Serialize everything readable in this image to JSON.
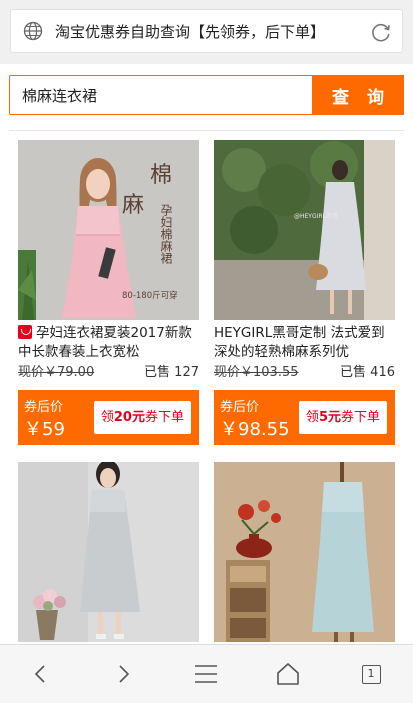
{
  "address_bar": {
    "title": "淘宝优惠券自助查询【先领券，后下单】"
  },
  "search": {
    "value": "棉麻连衣裙",
    "button_label": "查 询"
  },
  "products": [
    {
      "title": "孕妇连衣裙夏装2017新款中长款春装上衣宽松",
      "tmall_badge": true,
      "image_caption_big": [
        "棉",
        "麻"
      ],
      "image_caption_small": "孕妇棉麻裙",
      "image_caption_size": "80-180斤可穿",
      "was_price": "现价￥79.00",
      "sold": "已售 127",
      "after_label": "券后价",
      "after_price": "￥59",
      "coupon_prefix": "领",
      "coupon_amount": "20元",
      "coupon_suffix": "券下单"
    },
    {
      "title": "HEYGIRL黑哥定制 法式爱到深处的轻熟棉麻系列优",
      "tmall_badge": false,
      "image_watermark": "@HEYGIRL黑哥",
      "was_price": "现价￥103.55",
      "sold": "已售 416",
      "after_label": "券后价",
      "after_price": "￥98.55",
      "coupon_prefix": "领",
      "coupon_amount": "5元",
      "coupon_suffix": "券下单"
    },
    {
      "title": "",
      "image_alt": "grey linen dress"
    },
    {
      "title": "",
      "image_alt": "light blue linen dress"
    }
  ],
  "bottom_nav": {
    "items": [
      "back-icon",
      "forward-icon",
      "menu-icon",
      "home-icon",
      "tabs-icon"
    ],
    "tab_count": "1"
  },
  "colors": {
    "accent": "#ff6a00",
    "coupon_text": "#e4001b",
    "background": "#ffffff"
  }
}
